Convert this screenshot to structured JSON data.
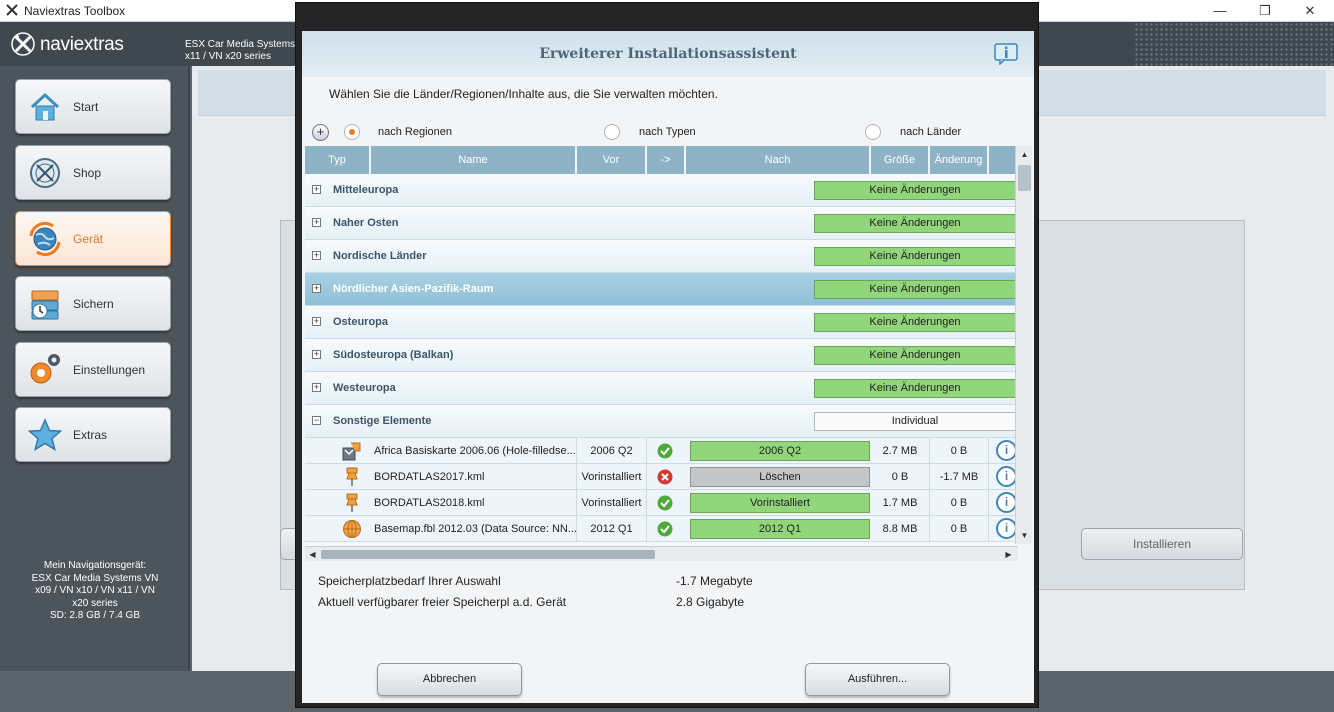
{
  "window": {
    "title": "Naviextras Toolbox",
    "minimize": "—",
    "maximize": "❐",
    "close": "✕"
  },
  "header": {
    "logo_text": "naviextras",
    "device_line1": "ESX Car Media Systems",
    "device_line2": "x11 / VN x20 series"
  },
  "sidebar": {
    "items": [
      {
        "label": "Start",
        "icon": "home-icon",
        "active": false
      },
      {
        "label": "Shop",
        "icon": "compass-icon",
        "active": false
      },
      {
        "label": "Gerät",
        "icon": "globe-sync-icon",
        "active": true
      },
      {
        "label": "Sichern",
        "icon": "backup-icon",
        "active": false
      },
      {
        "label": "Einstellungen",
        "icon": "gears-icon",
        "active": false
      },
      {
        "label": "Extras",
        "icon": "star-icon",
        "active": false
      }
    ],
    "device_info": [
      "Mein Navigationsgerät:",
      "ESX Car Media Systems VN",
      "x09 / VN x10 / VN x11 / VN",
      "x20 series",
      "SD: 2.8 GB / 7.4 GB"
    ]
  },
  "background": {
    "install_button": "Installieren"
  },
  "dialog": {
    "title": "Erweiterer Installationsassistent",
    "instruction": "Wählen Sie die Länder/Regionen/Inhalte aus, die Sie verwalten möchten.",
    "expand_all": "+",
    "view_options": [
      {
        "label": "nach Regionen",
        "checked": true
      },
      {
        "label": "nach Typen",
        "checked": false
      },
      {
        "label": "nach Länder",
        "checked": false
      }
    ],
    "columns": [
      "Typ",
      "Name",
      "Vor",
      "->",
      "Nach",
      "Größe",
      "Änderung"
    ],
    "regions": [
      {
        "name": "Mitteleuropa",
        "status": "Keine Änderungen",
        "expand": "+",
        "selected": false
      },
      {
        "name": "Naher Osten",
        "status": "Keine Änderungen",
        "expand": "+",
        "selected": false
      },
      {
        "name": "Nordische Länder",
        "status": "Keine Änderungen",
        "expand": "+",
        "selected": false
      },
      {
        "name": "Nördlicher Asien-Pazifik-Raum",
        "status": "Keine Änderungen",
        "expand": "+",
        "selected": true
      },
      {
        "name": "Osteuropa",
        "status": "Keine Änderungen",
        "expand": "+",
        "selected": false
      },
      {
        "name": "Südosteuropa (Balkan)",
        "status": "Keine Änderungen",
        "expand": "+",
        "selected": false
      },
      {
        "name": "Westeuropa",
        "status": "Keine Änderungen",
        "expand": "+",
        "selected": false
      },
      {
        "name": "Sonstige Elemente",
        "status": "Individual",
        "expand": "−",
        "selected": false
      }
    ],
    "items": [
      {
        "icon": "map-package-icon",
        "name": "Africa Basiskarte 2006.06 (Hole-filledse...",
        "vor": "2006 Q2",
        "state": "ok",
        "nach": "2006 Q2",
        "nach_style": "green",
        "size": "2.7 MB",
        "change": "0 B",
        "info": "i"
      },
      {
        "icon": "pushpin-icon",
        "name": "BORDATLAS2017.kml",
        "vor": "Vorinstalliert",
        "state": "remove",
        "nach": "Löschen",
        "nach_style": "grey",
        "size": "0 B",
        "change": "-1.7 MB",
        "info": "i"
      },
      {
        "icon": "pushpin-icon",
        "name": "BORDATLAS2018.kml",
        "vor": "Vorinstalliert",
        "state": "ok",
        "nach": "Vorinstalliert",
        "nach_style": "green",
        "size": "1.7 MB",
        "change": "0 B",
        "info": "i"
      },
      {
        "icon": "globe-icon",
        "name": "Basemap.fbl 2012.03 (Data Source: NN...",
        "vor": "2012 Q1",
        "state": "ok",
        "nach": "2012 Q1",
        "nach_style": "green",
        "size": "8.8 MB",
        "change": "0 B",
        "info": "i"
      }
    ],
    "summary": [
      {
        "label": "Speicherplatzbedarf Ihrer Auswahl",
        "value": "-1.7 Megabyte"
      },
      {
        "label": "Aktuell verfügbarer freier Speicherpl a.d. Gerät",
        "value": "2.8 Gigabyte"
      }
    ],
    "cancel_button": "Abbrechen",
    "run_button": "Ausführen..."
  },
  "colors": {
    "accent": "#f07a1c",
    "header_bg": "#3f474f",
    "table_header": "#8fb3c6",
    "status_green": "#92d67c",
    "selected_row": "#9ac7dc",
    "title_text": "#4d6577"
  }
}
